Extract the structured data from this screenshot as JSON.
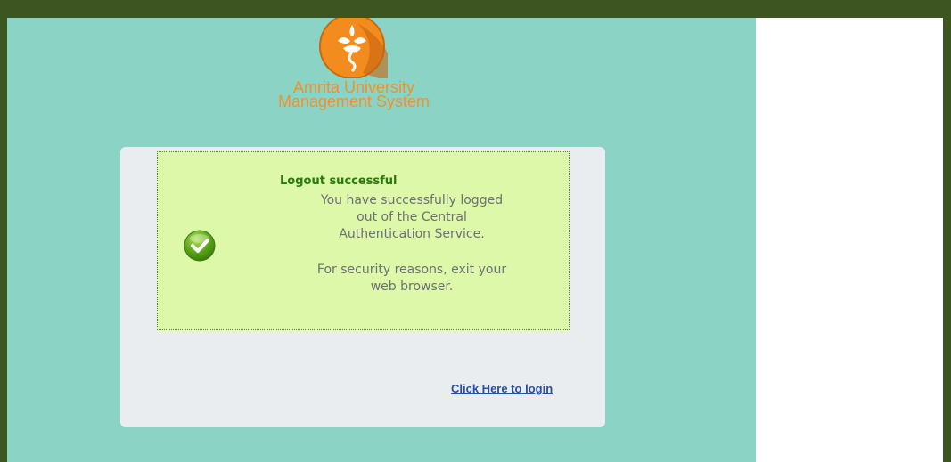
{
  "header": {
    "logo_icon": "amrita-lotus-logo-icon",
    "brand_line1": "Amrita University",
    "brand_line2": "Management System"
  },
  "message": {
    "status_icon": "success-check-icon",
    "title": "Logout successful",
    "body_lines": [
      "You have successfully logged",
      "out of the Central",
      "Authentication Service.",
      "For security reasons, exit your",
      "web browser."
    ]
  },
  "actions": {
    "login_link": "Click Here to login"
  },
  "colors": {
    "frame": "#3d5620",
    "panel": "#8bd3c5",
    "card": "#e9edf0",
    "message_bg": "#dcf8a8",
    "title": "#2a7a0f",
    "brand": "#f0922a",
    "link": "#2b4ea3"
  }
}
